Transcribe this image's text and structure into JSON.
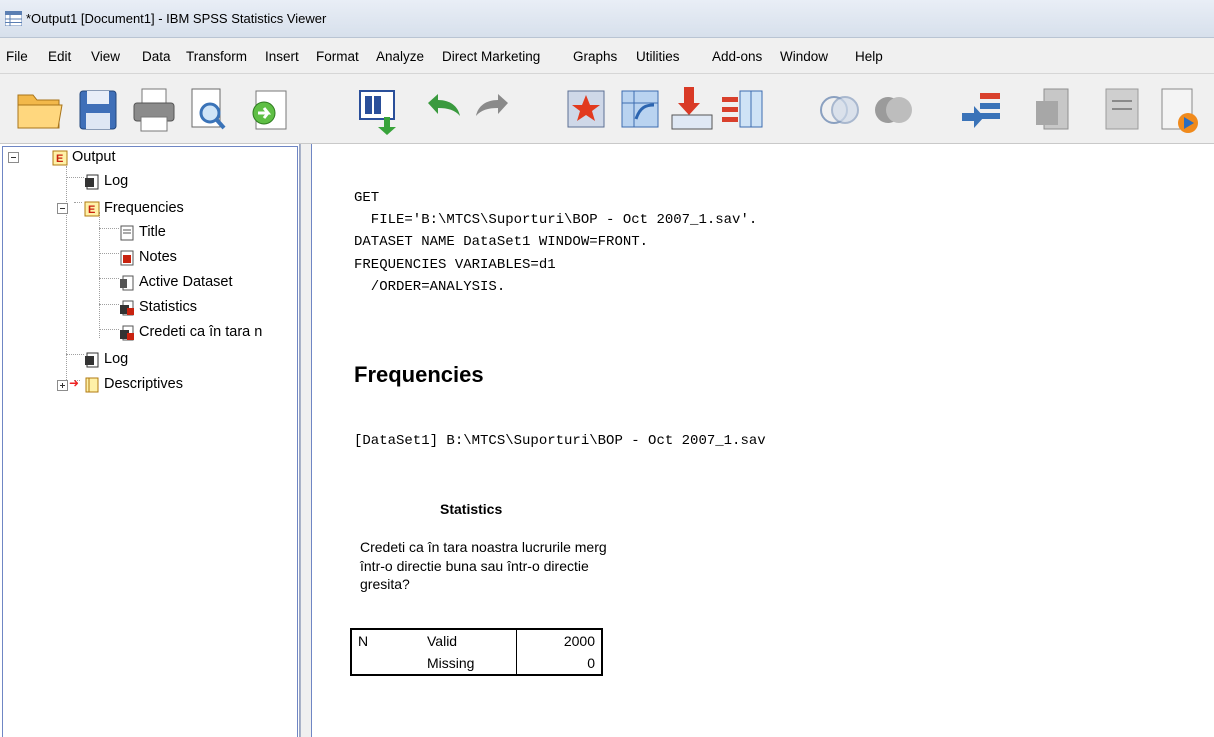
{
  "window": {
    "title": "*Output1 [Document1] - IBM SPSS Statistics Viewer"
  },
  "menu": [
    "File",
    "Edit",
    "View",
    "Data",
    "Transform",
    "Insert",
    "Format",
    "Analyze",
    "Direct Marketing",
    "Graphs",
    "Utilities",
    "Add-ons",
    "Window",
    "Help"
  ],
  "toolbar": {
    "buttons": [
      "open-folder-icon",
      "save-icon",
      "print-icon",
      "print-preview-icon",
      "export-icon",
      "recall-dialog-icon",
      "undo-icon",
      "redo-icon",
      "goto-data-icon",
      "goto-case-icon",
      "insert-cases-icon",
      "variables-icon",
      "venn-icon",
      "select-last-output-icon",
      "designate-window-icon",
      "promote-icon",
      "collapse-icon",
      "show-icon"
    ]
  },
  "outline": {
    "nodes": [
      {
        "label": "Output",
        "icon": "output-book-icon"
      },
      {
        "label": "Log",
        "icon": "log-icon"
      },
      {
        "label": "Frequencies",
        "icon": "frequencies-book-icon"
      },
      {
        "label": "Title",
        "icon": "title-icon"
      },
      {
        "label": "Notes",
        "icon": "notes-icon"
      },
      {
        "label": "Active Dataset",
        "icon": "dataset-icon"
      },
      {
        "label": "Statistics",
        "icon": "table-icon"
      },
      {
        "label": "Credeti ca în tara n",
        "icon": "table-icon"
      },
      {
        "label": "Log",
        "icon": "log-icon"
      },
      {
        "label": "Descriptives",
        "icon": "descriptives-book-icon"
      }
    ]
  },
  "content": {
    "syntax": "GET\n  FILE='B:\\MTCS\\Suporturi\\BOP - Oct 2007_1.sav'.\nDATASET NAME DataSet1 WINDOW=FRONT.\nFREQUENCIES VARIABLES=d1\n  /ORDER=ANALYSIS.",
    "heading": "Frequencies",
    "dataset_line": "[DataSet1] B:\\MTCS\\Suporturi\\BOP - Oct 2007_1.sav",
    "stats_title": "Statistics",
    "stats_caption": "Credeti ca în tara noastra lucrurile merg într-o directie buna sau într-o directie gresita?",
    "stats_table": {
      "rows": [
        {
          "c1": "N",
          "c2": "Valid",
          "c3": "2000"
        },
        {
          "c1": "",
          "c2": "Missing",
          "c3": "0"
        }
      ]
    }
  }
}
